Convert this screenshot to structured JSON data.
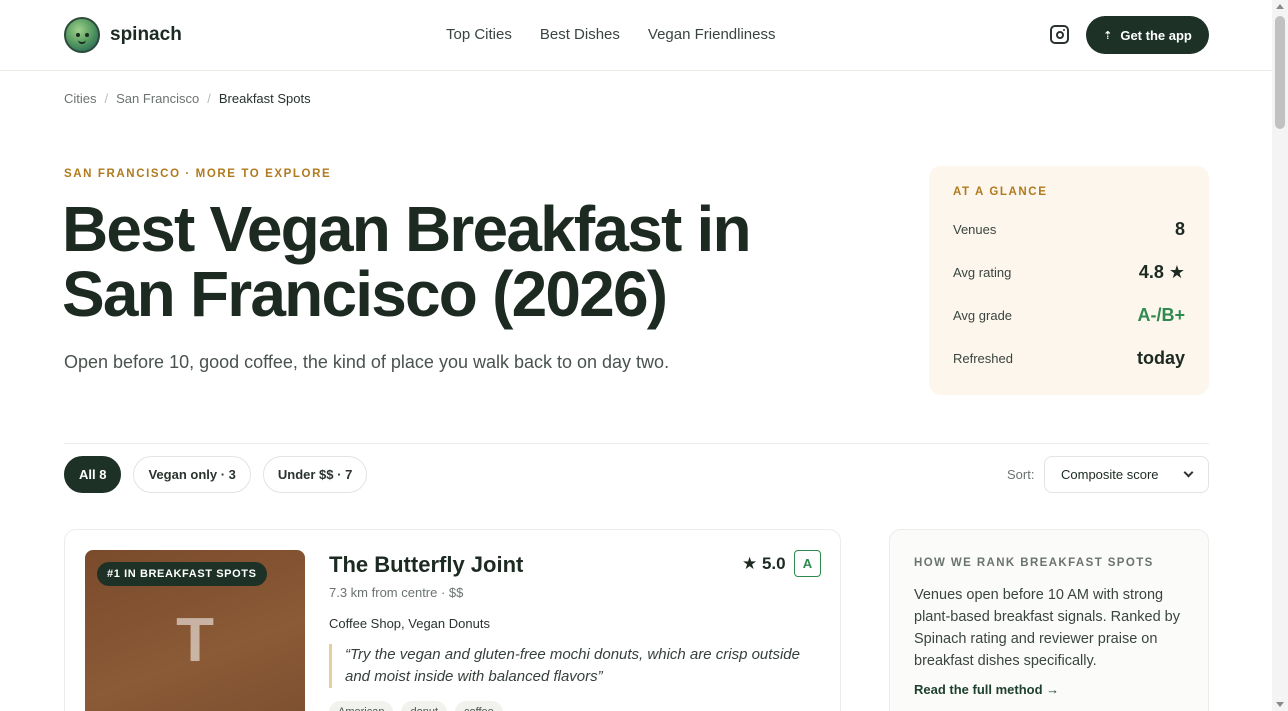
{
  "header": {
    "brand": "spinach",
    "nav": [
      "Top Cities",
      "Best Dishes",
      "Vegan Friendliness"
    ],
    "cta_label": "Get the app",
    "cta_icon": "upload-icon",
    "social_icon": "instagram-icon"
  },
  "breadcrumb": {
    "items": [
      "Cities",
      "San Francisco",
      "Breakfast Spots"
    ],
    "separator": "/"
  },
  "hero": {
    "eyebrow": "SAN FRANCISCO · MORE TO EXPLORE",
    "title_line1": "Best Vegan Breakfast in",
    "title_line2": "San Francisco (2026)",
    "subtitle": "Open before 10, good coffee, the kind of place you walk back to on day two."
  },
  "glance": {
    "title": "AT A GLANCE",
    "rows": [
      {
        "label": "Venues",
        "value": "8"
      },
      {
        "label": "Avg rating",
        "value": "4.8 ★"
      },
      {
        "label": "Avg grade",
        "value": "A-/B+"
      },
      {
        "label": "Refreshed",
        "value": "today"
      }
    ]
  },
  "filters": {
    "chips": [
      "All 8",
      "Vegan only · 3",
      "Under $$ · 7"
    ],
    "sort_label": "Sort:",
    "sort_value": "Composite score"
  },
  "venue": {
    "rank_badge": "#1 IN BREAKFAST SPOTS",
    "thumb_letter": "T",
    "name": "The Butterfly Joint",
    "meta": "7.3 km from centre · $$",
    "categories": "Coffee Shop, Vegan Donuts",
    "rating": "★ 5.0",
    "grade": "A",
    "quote": "“Try the vegan and gluten-free mochi donuts, which are crisp outside and moist inside with balanced flavors”",
    "tags": [
      "American",
      "donut",
      "coffee"
    ]
  },
  "method": {
    "title": "HOW WE RANK BREAKFAST SPOTS",
    "body": "Venues open before 10 AM with strong plant-based breakfast signals. Ranked by Spinach rating and reviewer praise on breakfast dishes specifically.",
    "link": "Read the full method →"
  },
  "colors": {
    "brand_dark": "#1d3127",
    "accent_gold": "#b07a1e",
    "grade_green": "#2f8a50",
    "glance_bg": "#fcf6ec"
  }
}
